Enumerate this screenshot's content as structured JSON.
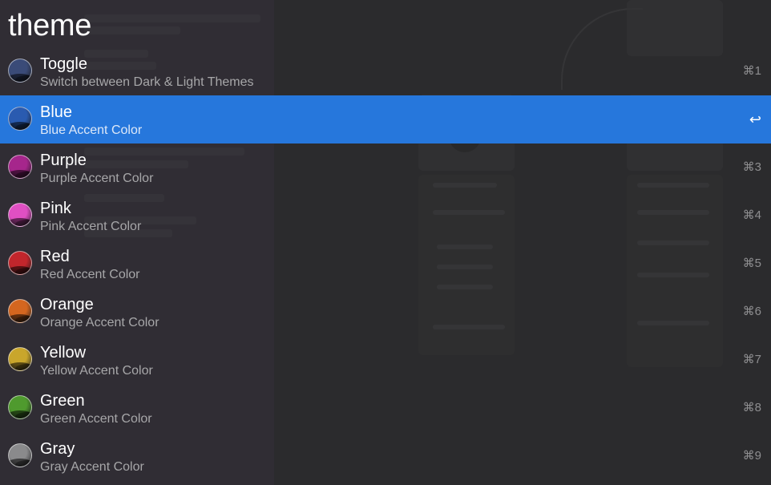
{
  "query": "theme",
  "results": [
    {
      "title": "Toggle",
      "subtitle": "Switch between Dark & Light Themes",
      "shortcut": "⌘1",
      "icon": "theme-toggle-icon",
      "color": "#3a4b78",
      "selected": false
    },
    {
      "title": "Blue",
      "subtitle": "Blue Accent Color",
      "shortcut": "↩",
      "icon": "blue-accent-icon",
      "color": "#2a5bb0",
      "selected": true
    },
    {
      "title": "Purple",
      "subtitle": "Purple Accent Color",
      "shortcut": "⌘3",
      "icon": "purple-accent-icon",
      "color": "#a6268c",
      "selected": false
    },
    {
      "title": "Pink",
      "subtitle": "Pink Accent Color",
      "shortcut": "⌘4",
      "icon": "pink-accent-icon",
      "color": "#e04fc3",
      "selected": false
    },
    {
      "title": "Red",
      "subtitle": "Red Accent Color",
      "shortcut": "⌘5",
      "icon": "red-accent-icon",
      "color": "#c2262c",
      "selected": false
    },
    {
      "title": "Orange",
      "subtitle": "Orange Accent Color",
      "shortcut": "⌘6",
      "icon": "orange-accent-icon",
      "color": "#d4661f",
      "selected": false
    },
    {
      "title": "Yellow",
      "subtitle": "Yellow Accent Color",
      "shortcut": "⌘7",
      "icon": "yellow-accent-icon",
      "color": "#c9a62c",
      "selected": false
    },
    {
      "title": "Green",
      "subtitle": "Green Accent Color",
      "shortcut": "⌘8",
      "icon": "green-accent-icon",
      "color": "#4f9a2e",
      "selected": false
    },
    {
      "title": "Gray",
      "subtitle": "Gray Accent Color",
      "shortcut": "⌘9",
      "icon": "gray-accent-icon",
      "color": "#8a8a8c",
      "selected": false
    }
  ],
  "colors": {
    "selection": "#2677dc",
    "background": "#2f2f31",
    "subtitle": "#a7a7a9",
    "shortcut": "#8e8e90"
  }
}
